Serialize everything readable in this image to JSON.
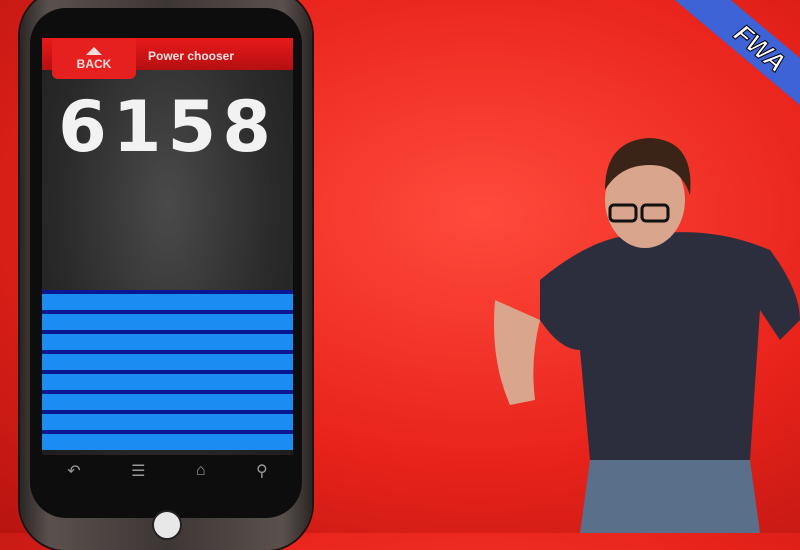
{
  "app": {
    "back_label": "BACK",
    "title": "Power chooser",
    "counter": "6158",
    "power_meter": {
      "filled_bars": 8,
      "level_fraction": 0.4
    }
  },
  "nav_icons": [
    "back-icon",
    "menu-icon",
    "home-icon",
    "search-icon"
  ],
  "watermark": "FWA",
  "colors": {
    "accent": "#e8191b",
    "meter": "#1a8cf2",
    "background": "#e8231b"
  }
}
